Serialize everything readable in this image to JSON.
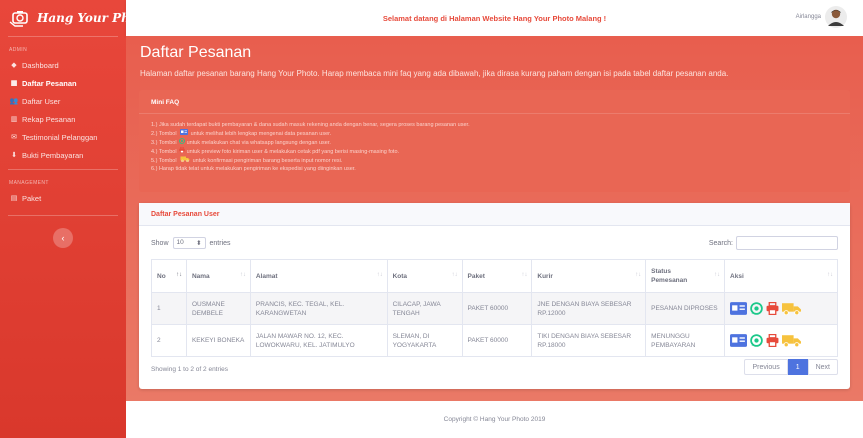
{
  "brand": {
    "name": "Hang Your Photo",
    "logo_icon": "camera-hand-logo"
  },
  "sidebar": {
    "section_admin": "ADMIN",
    "items": [
      {
        "label": "Dashboard",
        "icon": "dashboard-icon"
      },
      {
        "label": "Daftar Pesanan",
        "icon": "list-icon"
      },
      {
        "label": "Daftar User",
        "icon": "users-icon"
      },
      {
        "label": "Rekap Pesanan",
        "icon": "recap-icon"
      },
      {
        "label": "Testimonial Pelanggan",
        "icon": "comments-icon"
      },
      {
        "label": "Bukti Pembayaran",
        "icon": "payment-icon"
      }
    ],
    "section_management": "MANAGEMENT",
    "management_items": [
      {
        "label": "Paket",
        "icon": "package-icon"
      }
    ],
    "toggle_icon": "chevron-left-icon"
  },
  "topbar": {
    "welcome": "Selamat datang di Halaman Website Hang Your Photo Malang !",
    "username": "Airlangga"
  },
  "page": {
    "title": "Daftar Pesanan",
    "description": "Halaman daftar pesanan barang Hang Your Photo. Harap membaca mini faq yang ada dibawah, jika dirasa kurang paham dengan isi pada tabel daftar pesanan anda."
  },
  "faq": {
    "title": "Mini FAQ",
    "items": [
      {
        "pre": "1.) Jika sudah terdapat bukti pembayaran & dana sudah masuk rekening anda dengan benar, segera proses barang pesanan user.",
        "icon": "",
        "post": ""
      },
      {
        "pre": "2.) Tombol",
        "icon": "id-card-icon",
        "post": "untuk melihat lebih lengkap mengenai data pesanan user."
      },
      {
        "pre": "3.) Tombol",
        "icon": "whatsapp-icon",
        "post": "untuk melakukan chat via whatsapp langsung dengan user."
      },
      {
        "pre": "4.) Tombol",
        "icon": "print-icon",
        "post": "untuk preview foto kiriman user & melakukan cetak pdf yang berisi masing-masing foto."
      },
      {
        "pre": "5.) Tombol",
        "icon": "truck-icon",
        "post": "untuk konfirmasi pengiriman barang beserta input nomor resi."
      },
      {
        "pre": "6.) Harap tidak telat untuk melakukan pengiriman ke ekspedisi yang diinginkan user.",
        "icon": "",
        "post": ""
      }
    ]
  },
  "card": {
    "title": "Daftar Pesanan User",
    "show_label": "Show",
    "entries_value": "10",
    "entries_label": "entries",
    "search_label": "Search:",
    "search_value": "",
    "info": "Showing 1 to 2 of 2 entries",
    "prev": "Previous",
    "page": "1",
    "next": "Next"
  },
  "table": {
    "columns": [
      "No",
      "Nama",
      "Alamat",
      "Kota",
      "Paket",
      "Kurir",
      "Status Pemesanan",
      "Aksi"
    ],
    "rows": [
      {
        "no": "1",
        "nama": "OUSMANE DEMBELE",
        "alamat": "PRANCIS, KEC. TEGAL, KEL. KARANGWETAN",
        "kota": "CILACAP, JAWA TENGAH",
        "paket": "PAKET 60000",
        "kurir": "JNE DENGAN BIAYA SEBESAR RP.12000",
        "status": "PESANAN DIPROSES"
      },
      {
        "no": "2",
        "nama": "KEKEYI BONEKA",
        "alamat": "JALAN MAWAR NO. 12, KEC. LOWOKWARU, KEL. JATIMULYO",
        "kota": "SLEMAN, DI YOGYAKARTA",
        "paket": "PAKET 60000",
        "kurir": "TIKI DENGAN BIAYA SEBESAR RP.18000",
        "status": "MENUNGGU PEMBAYARAN"
      }
    ],
    "action_icons": [
      "id-card-icon",
      "whatsapp-icon",
      "print-icon",
      "truck-icon"
    ]
  },
  "footer": {
    "text": "Copyright © Hang Your Photo 2019"
  },
  "colors": {
    "primary": "#e74a3b",
    "blue_action": "#4e73df",
    "whatsapp": "#1cc88a",
    "print": "#e74a3b",
    "truck": "#f6c23e"
  }
}
